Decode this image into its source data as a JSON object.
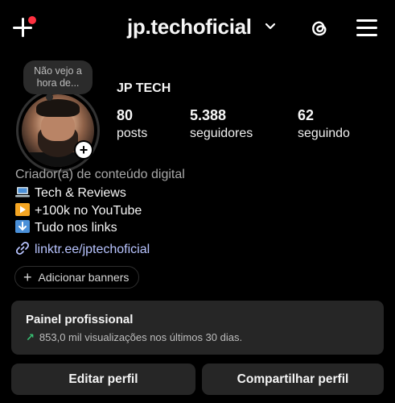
{
  "header": {
    "username": "jp.techoficial",
    "icons": [
      "new-post-icon",
      "chevron-down-icon",
      "threads-icon",
      "menu-icon"
    ]
  },
  "note": {
    "text": "Não vejo a hora de..."
  },
  "profile": {
    "display_name": "JP TECH",
    "stats": [
      {
        "value": "80",
        "label": "posts"
      },
      {
        "value": "5.388",
        "label": "seguidores"
      },
      {
        "value": "62",
        "label": "seguindo"
      }
    ]
  },
  "bio": {
    "category": "Criador(a) de conteúdo digital",
    "lines": [
      {
        "icon": "laptop-emoji",
        "text": "Tech & Reviews"
      },
      {
        "icon": "play-emoji",
        "text": "+100k no YouTube"
      },
      {
        "icon": "down-arrow-emoji",
        "text": "Tudo nos links"
      }
    ],
    "link": "linktr.ee/jptechoficial"
  },
  "banners": {
    "label": "Adicionar banners"
  },
  "professional_panel": {
    "title": "Painel profissional",
    "subtitle": "853,0 mil visualizações nos últimos 30 dias."
  },
  "actions": {
    "edit_label": "Editar perfil",
    "share_label": "Compartilhar perfil"
  },
  "colors": {
    "background": "#000000",
    "notification_dot": "#ff3040",
    "link": "#b8c4ff",
    "trend_green": "#37c173",
    "panel": "#262626"
  }
}
